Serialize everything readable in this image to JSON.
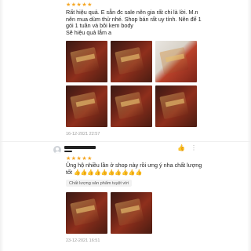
{
  "review1": {
    "stars": "★★★★★",
    "text": "Rất hiệu quả. E sẵn đc sale nên gia rất chi là lời. M.n\nnên mua dùm thử nhé. Shop bán rất uy tính. Nên để 1\ngói  1 tuần và bôi kem body\n Sẽ hiệu quả lắm a",
    "timestamp": "16-12-2021 22:57"
  },
  "review2": {
    "stars": "★★★★★",
    "text": "Ủng hộ nhiều lần ở shop này rồi ưng ý nha chất lượng\ntốt ",
    "emojis": "👍👍👍👍👍👍👍👍👍👍",
    "tag": "Chất lượng sản phẩm tuyệt vời",
    "timestamp": "23-12-2021 16:51"
  },
  "icons": {
    "like": "👍",
    "more": "⋮"
  },
  "colors": {
    "star": "#f5a623",
    "product_red": "#8f2f1c",
    "product_gold": "#d6a05a"
  }
}
